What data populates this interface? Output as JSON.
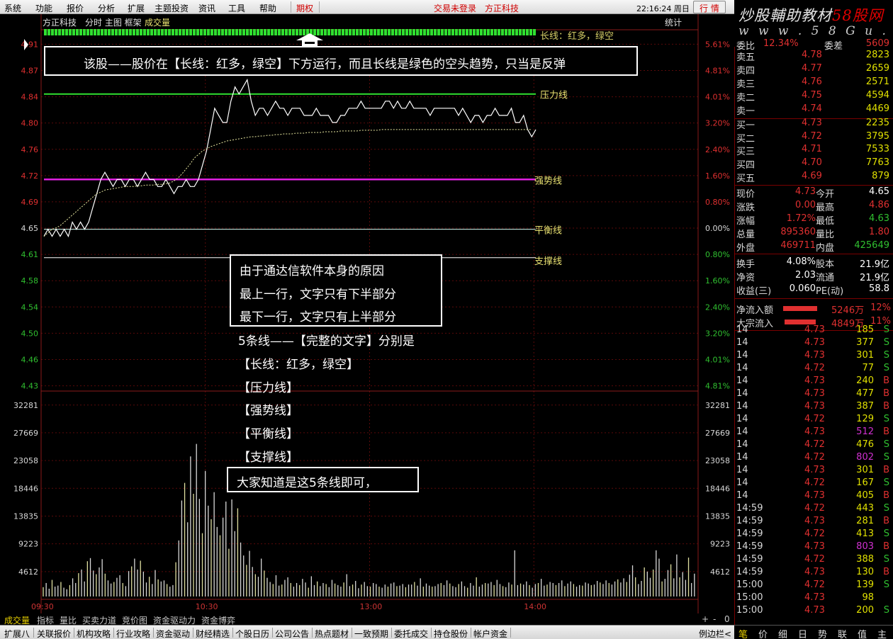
{
  "menu": {
    "items": [
      "系统",
      "功能",
      "报价",
      "分析",
      "扩展",
      "主题投资",
      "资讯",
      "工具",
      "帮助"
    ],
    "qiquan": "期权",
    "login": "交易未登录",
    "stock": "方正科技",
    "clock": "22:16:24 周日",
    "hq": "行 情"
  },
  "logo": {
    "line1a": "炒股輔助教材",
    "line1b": "58股网",
    "line2": "w w w . 5 8 G u . c o m"
  },
  "chart": {
    "title": "方正科技",
    "mode": "分时 主图 框架",
    "vol_label": "成交量",
    "stats": "统计",
    "price_ticks": [
      "4.91",
      "4.87",
      "4.84",
      "4.80",
      "4.76",
      "4.72",
      "4.69",
      "4.65",
      "4.61",
      "4.58",
      "4.54",
      "4.50",
      "4.46",
      "4.43"
    ],
    "pct_ticks": [
      "5.61%",
      "4.81%",
      "4.01%",
      "3.20%",
      "2.40%",
      "1.60%",
      "0.80%",
      "0.00%",
      "0.80%",
      "1.60%",
      "2.40%",
      "3.20%",
      "4.01%",
      "4.81%"
    ],
    "vol_ticks": [
      "32281",
      "27669",
      "23058",
      "18446",
      "13835",
      "9223",
      "4612"
    ],
    "time_ticks": [
      "09:30",
      "10:30",
      "13:00",
      "14:00"
    ],
    "line_labels": {
      "long": "长线：红多，绿空",
      "pressure": "压力线",
      "strong": "强势线",
      "balance": "平衡线",
      "support": "支撑线"
    },
    "colors": {
      "long": "#30e030",
      "pressure": "#30e030",
      "strong": "#e020e0",
      "balance": "#b8e0d8",
      "support": "#ffffff",
      "label": "#e8e070"
    },
    "prev_close": 4.65,
    "price_min": 4.43,
    "price_max": 4.91,
    "levels": {
      "pressure": 4.84,
      "strong": 4.72,
      "balance": 4.65,
      "support": 4.61
    },
    "price_series": [
      4.64,
      4.65,
      4.64,
      4.65,
      4.64,
      4.65,
      4.64,
      4.66,
      4.65,
      4.66,
      4.65,
      4.66,
      4.68,
      4.7,
      4.72,
      4.73,
      4.72,
      4.71,
      4.72,
      4.72,
      4.71,
      4.72,
      4.72,
      4.71,
      4.72,
      4.73,
      4.72,
      4.72,
      4.71,
      4.71,
      4.72,
      4.71,
      4.7,
      4.71,
      4.71,
      4.72,
      4.71,
      4.71,
      4.72,
      4.74,
      4.76,
      4.79,
      4.82,
      4.81,
      4.8,
      4.8,
      4.83,
      4.85,
      4.84,
      4.85,
      4.86,
      4.83,
      4.81,
      4.82,
      4.82,
      4.81,
      4.82,
      4.83,
      4.82,
      4.82,
      4.81,
      4.82,
      4.82,
      4.82,
      4.81,
      4.81,
      4.81,
      4.82,
      4.81,
      4.81,
      4.81,
      4.8,
      4.8,
      4.81,
      4.81,
      4.82,
      4.82,
      4.82,
      4.83,
      4.82,
      4.82,
      4.82,
      4.82,
      4.82,
      4.83,
      4.83,
      4.82,
      4.83,
      4.82,
      4.82,
      4.83,
      4.82,
      4.82,
      4.82,
      4.82,
      4.81,
      4.82,
      4.82,
      4.82,
      4.82,
      4.82,
      4.82,
      4.81,
      4.82,
      4.81,
      4.8,
      4.81,
      4.81,
      4.8,
      4.81,
      4.81,
      4.82,
      4.81,
      4.81,
      4.81,
      4.82,
      4.8,
      4.8,
      4.81,
      4.79,
      4.78,
      4.79
    ],
    "avg_series": [
      4.64,
      4.645,
      4.65,
      4.652,
      4.655,
      4.66,
      4.665,
      4.67,
      4.675,
      4.68,
      4.685,
      4.69,
      4.695,
      4.7,
      4.702,
      4.705,
      4.706,
      4.707,
      4.708,
      4.709,
      4.71,
      4.71,
      4.71,
      4.711,
      4.711,
      4.712,
      4.712,
      4.712,
      4.713,
      4.713,
      4.714,
      4.715,
      4.718,
      4.722,
      4.728,
      4.735,
      4.742,
      4.75,
      4.755,
      4.76,
      4.763,
      4.766,
      4.768,
      4.77,
      4.772,
      4.774,
      4.775,
      4.776,
      4.777,
      4.778,
      4.779,
      4.78,
      4.78,
      4.781,
      4.781,
      4.782,
      4.782,
      4.783,
      4.783,
      4.784,
      4.784,
      4.784,
      4.785,
      4.785,
      4.785,
      4.786,
      4.786,
      4.786,
      4.786,
      4.787,
      4.787,
      4.787,
      4.787,
      4.788,
      4.788,
      4.788,
      4.788,
      4.788,
      4.789,
      4.789,
      4.789,
      4.789,
      4.789,
      4.79,
      4.79,
      4.79,
      4.79,
      4.79,
      4.79,
      4.79,
      4.79,
      4.79,
      4.79,
      4.79,
      4.79,
      4.79,
      4.79,
      4.79,
      4.79,
      4.79,
      4.79,
      4.79,
      4.79,
      4.79,
      4.79,
      4.79,
      4.79,
      4.79,
      4.79,
      4.79,
      4.79,
      4.79,
      4.79,
      4.79,
      4.79,
      4.79,
      4.79,
      4.79,
      4.79,
      4.79,
      4.79
    ],
    "vol_max": 36893,
    "volume_series": [
      1800,
      2600,
      1500,
      3200,
      1900,
      2100,
      2800,
      1700,
      1400,
      2200,
      3500,
      2600,
      4500,
      5200,
      2900,
      6800,
      7400,
      5000,
      4300,
      5600,
      7200,
      4400,
      3100,
      2500,
      2800,
      3600,
      4100,
      2600,
      2000,
      4900,
      5800,
      7300,
      5200,
      6900,
      4800,
      2700,
      3800,
      2400,
      5100,
      3300,
      2900,
      3100,
      2400,
      1900,
      2200,
      6600,
      10800,
      18500,
      21900,
      14300,
      27000,
      19800,
      29400,
      18800,
      12200,
      24200,
      17500,
      14900,
      20100,
      13400,
      11800,
      15200,
      18300,
      9200,
      18700,
      12600,
      17000,
      10400,
      7900,
      6100,
      8800,
      5700,
      4300,
      3800,
      7300,
      5000,
      3600,
      2800,
      2400,
      4100,
      2100,
      2300,
      3200,
      3700,
      2600,
      1900,
      2600,
      2200,
      3400,
      2700,
      1700,
      3900,
      2200,
      2900,
      2000,
      2600,
      2400,
      1800,
      3200,
      2500,
      2200,
      1900,
      2700,
      4300,
      2000,
      2300,
      3000,
      1600,
      2300,
      2800,
      2000,
      1900,
      2600,
      2400,
      1900,
      1700,
      2300,
      1900,
      2500,
      2700,
      2000,
      2100,
      2400,
      1800,
      2300,
      2300,
      2800,
      2100,
      3500,
      1900,
      2500,
      2100,
      1900,
      2000,
      2400,
      2600,
      2200,
      3100,
      2500,
      2000,
      1800,
      2400,
      2900,
      2000,
      1700,
      2600,
      2100,
      3700,
      1900,
      2300,
      2600,
      2500,
      2800,
      2200,
      3200,
      2400,
      2000,
      1800,
      2700,
      2300,
      8900,
      2200,
      2500,
      2300,
      2900,
      2200,
      1700,
      2400,
      2600,
      3400,
      2100,
      2300,
      2800,
      2600,
      2200,
      2600,
      3100,
      2000,
      2500,
      2900,
      2400,
      1900,
      2200,
      2100,
      2700,
      2500,
      2200,
      2300,
      3000,
      2700,
      2400,
      3100,
      2600,
      2300,
      2900,
      3300,
      2700,
      3500,
      2800,
      4200,
      6000,
      3700,
      2400,
      3000,
      5600,
      4800,
      3600,
      5200,
      8900,
      7300,
      2900,
      3400,
      5100,
      6200,
      3500,
      8100,
      3700,
      4700,
      3200,
      7500,
      2600,
      4400
    ]
  },
  "annotations": {
    "top": "该股——股价在【长线：红多，绿空】下方运行，而且长线是绿色的空头趋势，只当是反弹",
    "mid_box": [
      "由于通达信软件本身的原因",
      "最上一行，文字只有下半部分",
      "最下一行，文字只有上半部分"
    ],
    "list": [
      "5条线——【完整的文字】分别是",
      "【长线：红多，绿空】",
      "【压力线】",
      "【强势线】",
      "【平衡线】",
      "【支撑线】"
    ],
    "bottom": "大家知道是这5条线即可，"
  },
  "tabs": [
    "成交量",
    "指标",
    "量比",
    "买卖力道",
    "竞价图",
    "资金驱动力",
    "资金博弈"
  ],
  "tab_ctrl": [
    "+",
    "-",
    "0"
  ],
  "bottombar": [
    "扩展八",
    "关联报价",
    "机构攻略",
    "行业攻略",
    "资金驱动",
    "财经精选",
    "个股日历",
    "公司公告",
    "热点题材",
    "一致预期",
    "委托成交",
    "持仓股份",
    "帐户资金",
    "例边栏<"
  ],
  "rtabs": [
    "笔",
    "价",
    "细",
    "日",
    "势",
    "联",
    "值",
    "主"
  ],
  "quote": {
    "weibi_label": "委比",
    "weibi": "12.34%",
    "weicha_label": "委差",
    "weicha": "5609",
    "sells": [
      {
        "l": "卖五",
        "p": "4.78",
        "v": "2823"
      },
      {
        "l": "卖四",
        "p": "4.77",
        "v": "2659"
      },
      {
        "l": "卖三",
        "p": "4.76",
        "v": "2571"
      },
      {
        "l": "卖二",
        "p": "4.75",
        "v": "4594"
      },
      {
        "l": "卖一",
        "p": "4.74",
        "v": "4469"
      }
    ],
    "buys": [
      {
        "l": "买一",
        "p": "4.73",
        "v": "2235"
      },
      {
        "l": "买二",
        "p": "4.72",
        "v": "3795"
      },
      {
        "l": "买三",
        "p": "4.71",
        "v": "7533"
      },
      {
        "l": "买四",
        "p": "4.70",
        "v": "7763"
      },
      {
        "l": "买五",
        "p": "4.69",
        "v": "879"
      }
    ],
    "stats": [
      {
        "a": "现价",
        "b": "4.73",
        "c": "今开",
        "d": "4.65"
      },
      {
        "a": "涨跌",
        "b": "0.00",
        "c": "最高",
        "d": "4.86"
      },
      {
        "a": "涨幅",
        "b": "1.72%",
        "c": "最低",
        "d": "4.63"
      },
      {
        "a": "总量",
        "b": "895360",
        "c": "量比",
        "d": "1.80"
      },
      {
        "a": "外盘",
        "b": "469711",
        "c": "内盘",
        "d": "425649"
      },
      {
        "a": "换手",
        "b": "4.08%",
        "c": "股本",
        "d": "21.9亿"
      },
      {
        "a": "净资",
        "b": "2.03",
        "c": "流通",
        "d": "21.9亿"
      },
      {
        "a": "收益(三)",
        "b": "0.060",
        "c": "PE(动)",
        "d": "58.8"
      }
    ],
    "flows": [
      {
        "l": "净流入额",
        "v": "5246万",
        "p": "12%"
      },
      {
        "l": "大宗流入",
        "v": "4849万",
        "p": "11%"
      }
    ],
    "ticks": [
      {
        "t": "14",
        "p": "4.73",
        "v": "185",
        "s": "S"
      },
      {
        "t": "14",
        "p": "4.73",
        "v": "377",
        "s": "S"
      },
      {
        "t": "14",
        "p": "4.73",
        "v": "301",
        "s": "S"
      },
      {
        "t": "14",
        "p": "4.72",
        "v": "77",
        "s": "S"
      },
      {
        "t": "14",
        "p": "4.73",
        "v": "240",
        "s": "B"
      },
      {
        "t": "14",
        "p": "4.73",
        "v": "477",
        "s": "B"
      },
      {
        "t": "14",
        "p": "4.73",
        "v": "387",
        "s": "B"
      },
      {
        "t": "14",
        "p": "4.72",
        "v": "129",
        "s": "S"
      },
      {
        "t": "14",
        "p": "4.73",
        "v": "512",
        "s": "B"
      },
      {
        "t": "14",
        "p": "4.72",
        "v": "476",
        "s": "S"
      },
      {
        "t": "14",
        "p": "4.72",
        "v": "802",
        "s": "S"
      },
      {
        "t": "14",
        "p": "4.73",
        "v": "301",
        "s": "B"
      },
      {
        "t": "14",
        "p": "4.72",
        "v": "167",
        "s": "S"
      },
      {
        "t": "14",
        "p": "4.73",
        "v": "405",
        "s": "B"
      },
      {
        "t": "14:59",
        "p": "4.72",
        "v": "443",
        "s": "S"
      },
      {
        "t": "14:59",
        "p": "4.73",
        "v": "281",
        "s": "B"
      },
      {
        "t": "14:59",
        "p": "4.72",
        "v": "413",
        "s": "S"
      },
      {
        "t": "14:59",
        "p": "4.73",
        "v": "803",
        "s": "B"
      },
      {
        "t": "14:59",
        "p": "4.72",
        "v": "388",
        "s": "S"
      },
      {
        "t": "14:59",
        "p": "4.73",
        "v": "130",
        "s": "B"
      },
      {
        "t": "15:00",
        "p": "4.72",
        "v": "139",
        "s": "S"
      },
      {
        "t": "15:00",
        "p": "4.73",
        "v": "98",
        "s": ""
      },
      {
        "t": "15:00",
        "p": "4.73",
        "v": "200",
        "s": "S"
      }
    ]
  }
}
